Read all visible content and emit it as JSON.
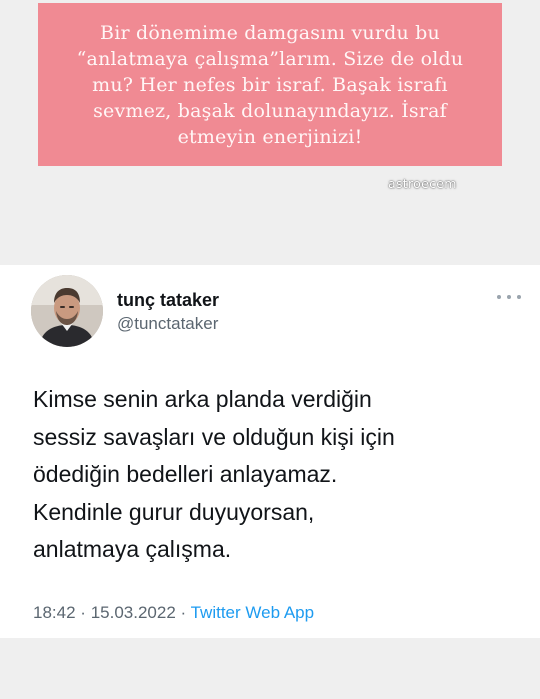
{
  "story": {
    "caption_lines": [
      "Bir dönemime damgasını vurdu bu",
      "“anlatmaya çalışma”larım. Size de oldu",
      "mu? Her nefes bir israf. Başak israfı",
      "sevmez, başak dolunayındayız. İsraf",
      "etmeyin enerjinizi!"
    ],
    "watermark": "astroecem"
  },
  "tweet": {
    "display_name": "tunç tataker",
    "handle": "@tunctataker",
    "more_icon": "more-horizontal-icon",
    "body_lines": [
      "Kimse senin arka planda verdiğin",
      "sessiz savaşları ve olduğun kişi için",
      "ödediğin bedelleri anlayamaz.",
      "Kendinle gurur duyuyorsan,",
      "anlatmaya çalışma."
    ],
    "time": "18:42",
    "date": "15.03.2022",
    "separator": "·",
    "source": "Twitter Web App"
  },
  "colors": {
    "caption_bg": "#f08a93",
    "link": "#1d9bf0",
    "muted_text": "#5b6670"
  }
}
